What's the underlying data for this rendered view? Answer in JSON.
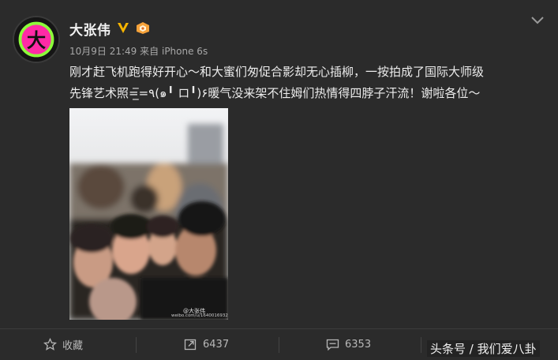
{
  "post": {
    "username": "大张伟",
    "timestamp": "10月9日 21:49",
    "source_prefix": "来自",
    "source": "iPhone 6s",
    "content_line1": "刚才赶飞机跑得好开心～和大蜜们匆促合影却无心插柳，一按拍成了国际大师级",
    "content_line2": "先锋艺术照=̲̅=٩(๑╹ ロ╹)۶暖气没来架不住姆们热情得四脖子汗流！谢啦各位～",
    "image_watermark_brand": "@大张伟",
    "image_watermark_url": "weibo.com/u/1640016932"
  },
  "actions": {
    "favorite_label": "收藏",
    "repost_count": "6437",
    "comment_count": "6353"
  },
  "overlay_watermark": "头条号 / 我们爱八卦",
  "icons": {
    "verified": "verified-v-icon",
    "level": "user-level-icon",
    "menu": "chevron-down-icon",
    "favorite": "star-icon",
    "repost": "repost-icon",
    "comment": "comment-icon"
  },
  "colors": {
    "background": "#2b2b2b",
    "verified": "#f6b400",
    "avatar_ring": "#8cff3a",
    "avatar_fill": "#ff2aa6"
  }
}
